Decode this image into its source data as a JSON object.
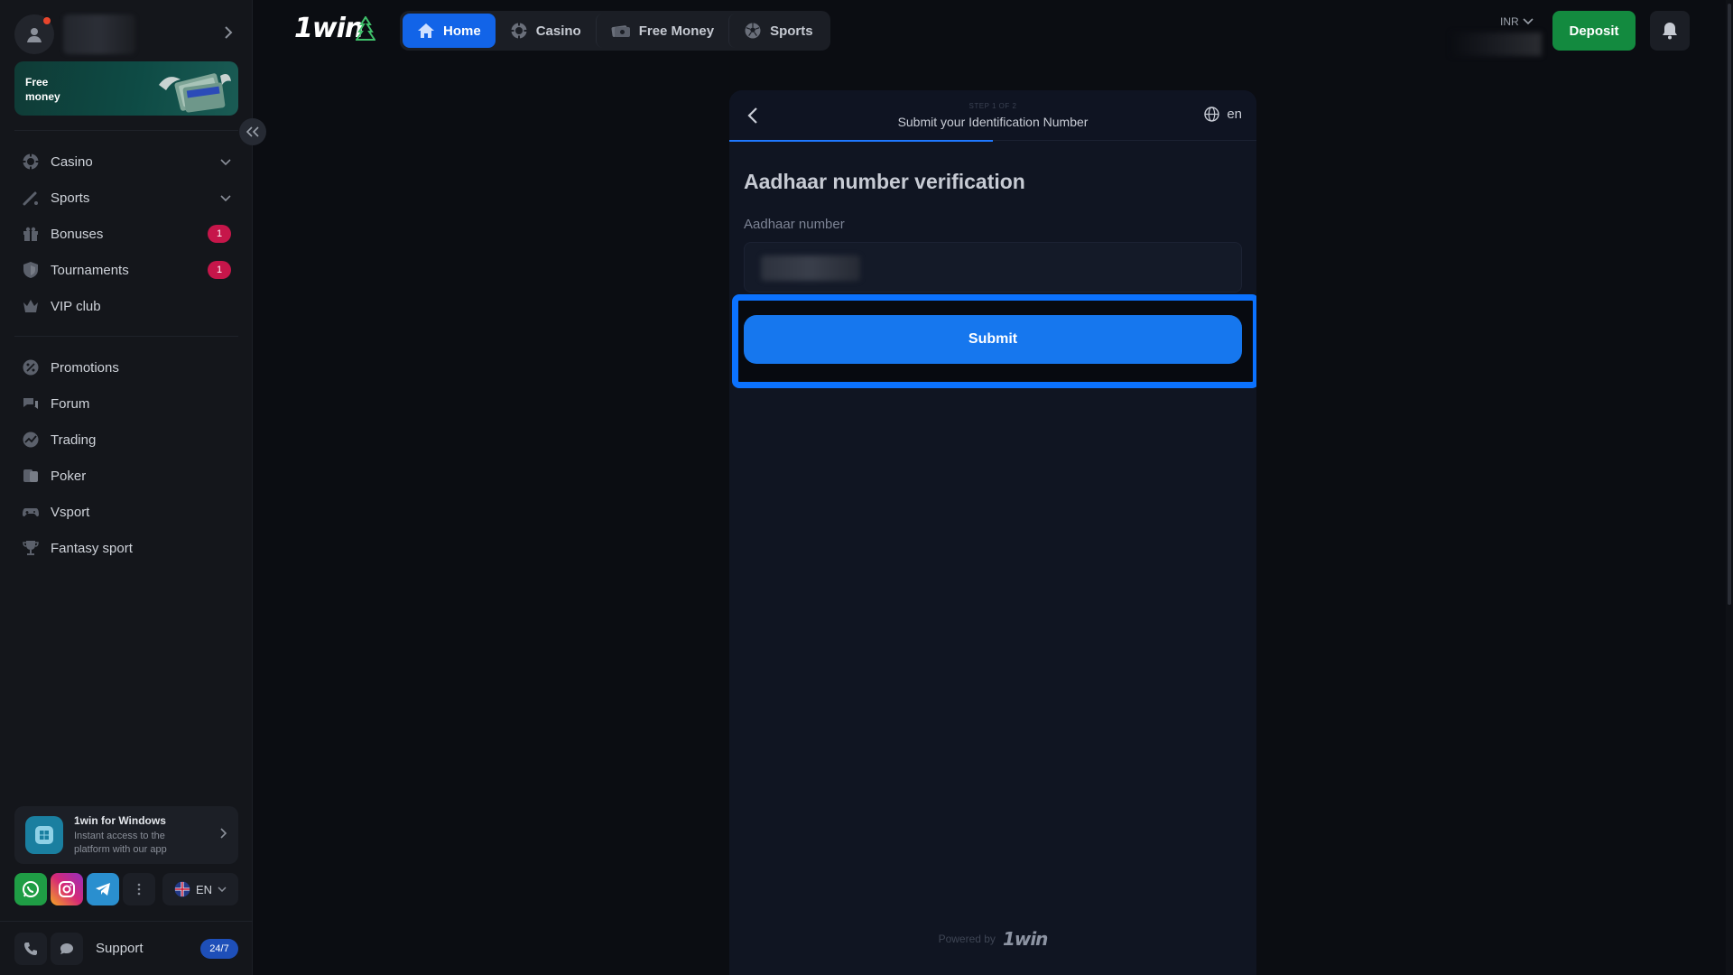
{
  "sidebar": {
    "free_money_label": "Free money",
    "nav_primary": [
      {
        "label": "Casino",
        "icon": "casino-chip-icon",
        "expandable": true
      },
      {
        "label": "Sports",
        "icon": "sports-icon",
        "expandable": true
      },
      {
        "label": "Bonuses",
        "icon": "gift-icon",
        "badge": "1"
      },
      {
        "label": "Tournaments",
        "icon": "shield-icon",
        "badge": "1"
      },
      {
        "label": "VIP club",
        "icon": "crown-icon"
      }
    ],
    "nav_secondary": [
      {
        "label": "Promotions",
        "icon": "percent-icon"
      },
      {
        "label": "Forum",
        "icon": "chat-bubbles-icon"
      },
      {
        "label": "Trading",
        "icon": "chart-icon"
      },
      {
        "label": "Poker",
        "icon": "cards-icon"
      },
      {
        "label": "Vsport",
        "icon": "gamepad-icon"
      },
      {
        "label": "Fantasy sport",
        "icon": "trophy-icon"
      }
    ],
    "app_card": {
      "title": "1win for Windows",
      "subtitle": "Instant access to the platform with our app"
    },
    "language": "EN",
    "support": {
      "label": "Support",
      "hours": "24/7"
    }
  },
  "topbar": {
    "logo": "1win",
    "tabs": [
      {
        "label": "Home",
        "icon": "home-icon",
        "active": true
      },
      {
        "label": "Casino",
        "icon": "casino-chip-icon",
        "active": false
      },
      {
        "label": "Free Money",
        "icon": "cash-icon",
        "active": false
      },
      {
        "label": "Sports",
        "icon": "soccer-ball-icon",
        "active": false
      }
    ],
    "currency": "INR",
    "deposit_label": "Deposit"
  },
  "modal": {
    "step_label": "STEP 1 OF 2",
    "title": "Submit your Identification Number",
    "language": "en",
    "heading": "Aadhaar number verification",
    "field_label": "Aadhaar number",
    "submit_label": "Submit",
    "powered_by": "Powered by",
    "powered_logo": "1win"
  },
  "colors": {
    "accent": "#1264e8",
    "deposit": "#138a3f",
    "badge": "#c6164a",
    "highlight": "#0b72ff"
  }
}
